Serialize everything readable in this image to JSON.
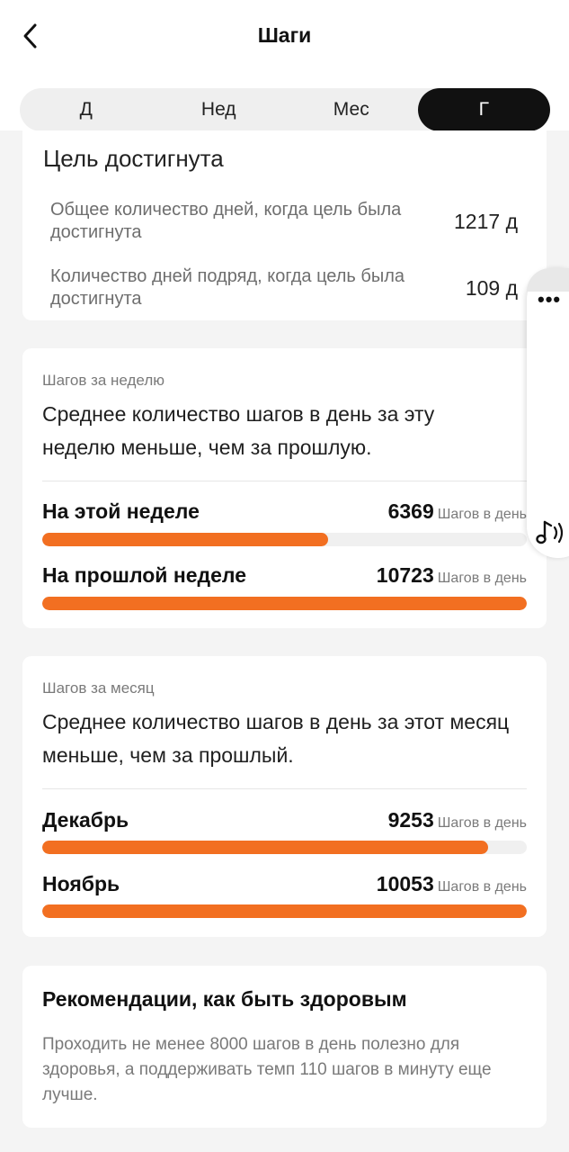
{
  "header": {
    "title": "Шаги"
  },
  "tabs": [
    {
      "label": "Д",
      "active": false
    },
    {
      "label": "Нед",
      "active": false
    },
    {
      "label": "Мес",
      "active": false
    },
    {
      "label": "Г",
      "active": true
    }
  ],
  "goal": {
    "title": "Цель достигнута",
    "rows": [
      {
        "label": "Общее количество дней, когда цель была достигнута",
        "value": "1217 д"
      },
      {
        "label": "Количество дней подряд, когда цель была достигнута",
        "value": "109 д"
      }
    ]
  },
  "weekly": {
    "kicker": "Шагов за неделю",
    "text": "Среднее количество шагов в день за эту неделю меньше, чем за прошлую.",
    "bars": [
      {
        "label": "На этой неделе",
        "value": "6369",
        "unit": "Шагов в день",
        "fraction": 0.59
      },
      {
        "label": "На прошлой неделе",
        "value": "10723",
        "unit": "Шагов в день",
        "fraction": 1.0
      }
    ]
  },
  "monthly": {
    "kicker": "Шагов за месяц",
    "text": "Среднее количество шагов в день за этот месяц меньше, чем за прошлый.",
    "bars": [
      {
        "label": "Декабрь",
        "value": "9253",
        "unit": "Шагов в день",
        "fraction": 0.92
      },
      {
        "label": "Ноябрь",
        "value": "10053",
        "unit": "Шагов в день",
        "fraction": 1.0
      }
    ]
  },
  "recommendation": {
    "title": "Рекомендации, как быть здоровым",
    "text": "Проходить не менее 8000 шагов в день полезно для здоровья, а поддерживать темп 110 шагов в минуту еще лучше."
  },
  "side_panel": {
    "more_icon": "more-dots-icon",
    "sound_icon": "sound-note-icon"
  },
  "colors": {
    "accent": "#f26f21",
    "active_tab": "#111111"
  }
}
